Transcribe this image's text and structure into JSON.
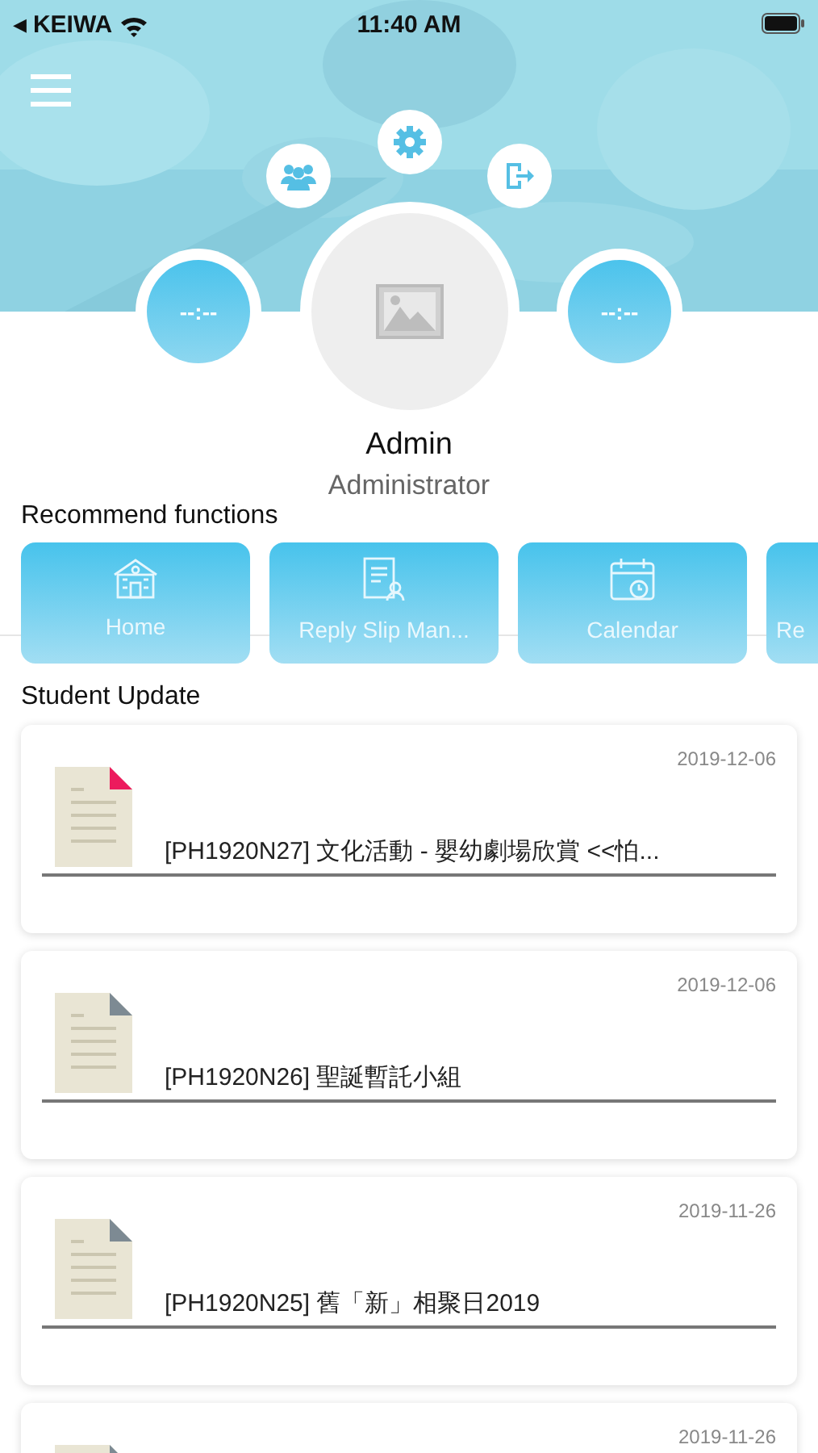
{
  "status_bar": {
    "back": "◀",
    "carrier": "KEIWA",
    "time": "11:40 AM"
  },
  "profile": {
    "left_time": "--:--",
    "right_time": "--:--",
    "name": "Admin",
    "role": "Administrator"
  },
  "recommend": {
    "title": "Recommend functions",
    "items": [
      {
        "label": "Home",
        "kind": "school"
      },
      {
        "label": "Reply Slip Man...",
        "kind": "slip"
      },
      {
        "label": "Calendar",
        "kind": "calendar"
      },
      {
        "label": "Re",
        "kind": "none"
      }
    ]
  },
  "updates": {
    "title": "Student Update",
    "items": [
      {
        "date": "2019-12-06",
        "title": "[PH1920N27] 文化活動 - 嬰幼劇場欣賞  <<怕...",
        "unread": true
      },
      {
        "date": "2019-12-06",
        "title": "[PH1920N26] 聖誕暫託小組",
        "unread": false
      },
      {
        "date": "2019-11-26",
        "title": "[PH1920N25] 舊「新」相聚日2019",
        "unread": false
      },
      {
        "date": "2019-11-26",
        "unread": false
      }
    ]
  }
}
